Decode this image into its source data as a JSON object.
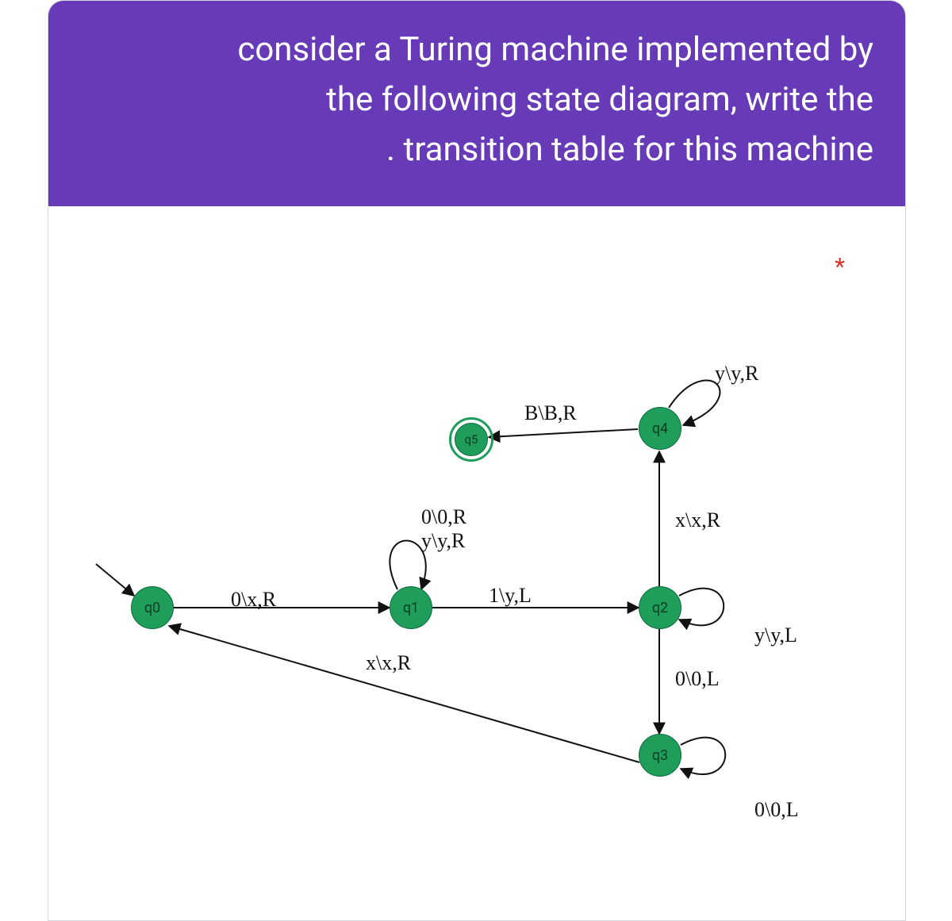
{
  "header": {
    "line1": "consider a Turing machine implemented by",
    "line2": "the following state diagram, write the",
    "line3": ". transition table for this machine"
  },
  "required_marker": "*",
  "states": {
    "q0": "q0",
    "q1": "q1",
    "q2": "q2",
    "q3": "q3",
    "q4": "q4",
    "q5": "q5"
  },
  "transitions": {
    "q0_q1": "0\\x,R",
    "q1_q1_a": "0\\0,R",
    "q1_q1_b": "y\\y,R",
    "q1_q2": "1\\y,L",
    "q2_q2": "y\\y,L",
    "q2_q3": "0\\0,L",
    "q2_q4": "x\\x,R",
    "q3_q3": "0\\0,L",
    "q3_q0": "x\\x,R",
    "q4_q4": "y\\y,R",
    "q4_q5": "B\\B,R"
  },
  "chart_data": {
    "type": "state_diagram",
    "machine": "Turing machine",
    "initial_state": "q0",
    "final_states": [
      "q5"
    ],
    "states": [
      "q0",
      "q1",
      "q2",
      "q3",
      "q4",
      "q5"
    ],
    "alphabet_input": [
      "0",
      "1",
      "x",
      "y",
      "B"
    ],
    "transitions": [
      {
        "from": "q0",
        "read": "0",
        "write": "x",
        "move": "R",
        "to": "q1"
      },
      {
        "from": "q1",
        "read": "0",
        "write": "0",
        "move": "R",
        "to": "q1"
      },
      {
        "from": "q1",
        "read": "y",
        "write": "y",
        "move": "R",
        "to": "q1"
      },
      {
        "from": "q1",
        "read": "1",
        "write": "y",
        "move": "L",
        "to": "q2"
      },
      {
        "from": "q2",
        "read": "y",
        "write": "y",
        "move": "L",
        "to": "q2"
      },
      {
        "from": "q2",
        "read": "0",
        "write": "0",
        "move": "L",
        "to": "q3"
      },
      {
        "from": "q2",
        "read": "x",
        "write": "x",
        "move": "R",
        "to": "q4"
      },
      {
        "from": "q3",
        "read": "0",
        "write": "0",
        "move": "L",
        "to": "q3"
      },
      {
        "from": "q3",
        "read": "x",
        "write": "x",
        "move": "R",
        "to": "q0"
      },
      {
        "from": "q4",
        "read": "y",
        "write": "y",
        "move": "R",
        "to": "q4"
      },
      {
        "from": "q4",
        "read": "B",
        "write": "B",
        "move": "R",
        "to": "q5"
      }
    ]
  }
}
